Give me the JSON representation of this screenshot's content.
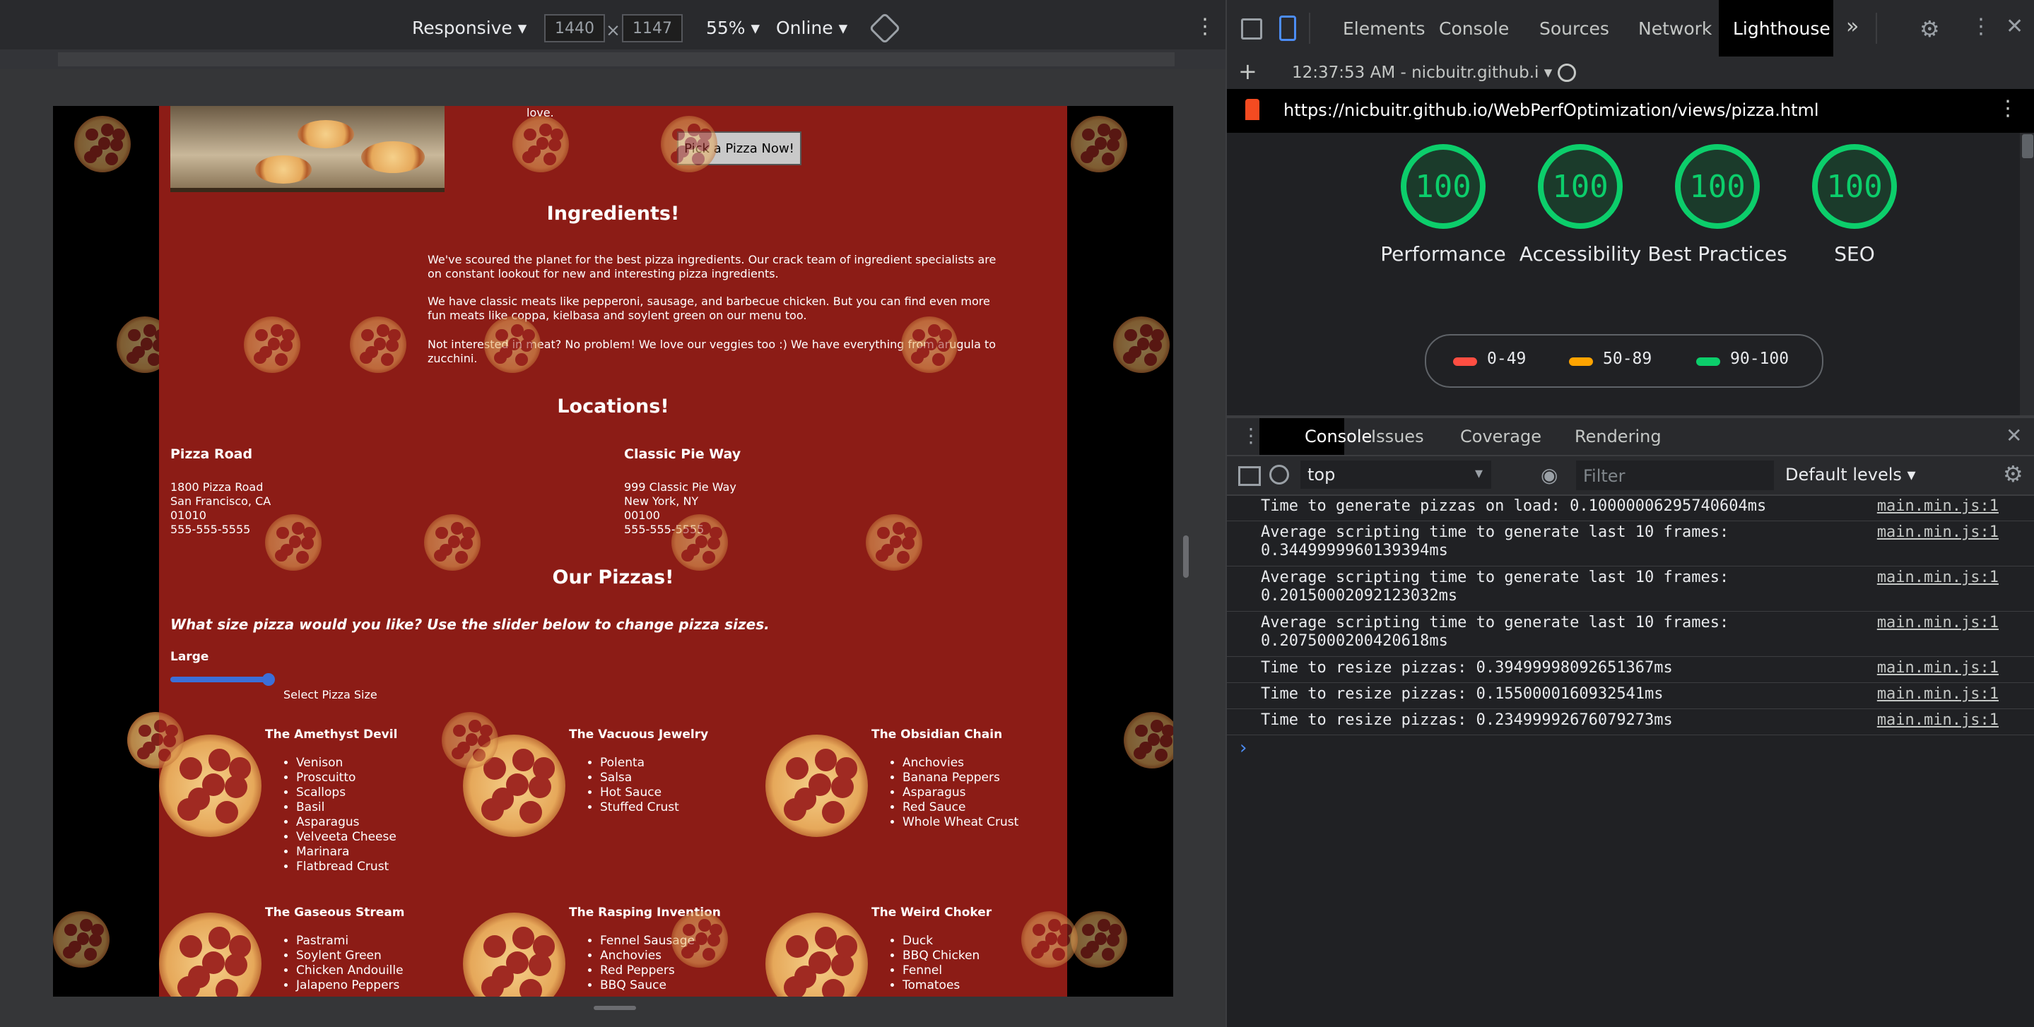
{
  "device_toolbar": {
    "mode": "Responsive",
    "width": "1440",
    "height": "1147",
    "times": "×",
    "zoom": "55%",
    "network": "Online"
  },
  "site": {
    "partial_text": "love.",
    "pick_button": "Pick a Pizza Now!",
    "ingredients_title": "Ingredients!",
    "ingredients_paras": [
      "We've scoured the planet for the best pizza ingredients. Our crack team of ingredient specialists are on constant lookout for new and interesting pizza ingredients.",
      "We have classic meats like pepperoni, sausage, and barbecue chicken. But you can find even more fun meats like coppa, kielbasa and soylent green on our menu too.",
      "Not interested in meat? No problem! We love our veggies too :) We have everything from arugula to zucchini."
    ],
    "locations_title": "Locations!",
    "locations": [
      {
        "name": "Pizza Road",
        "line1": "1800 Pizza Road",
        "line2": "San Francisco, CA",
        "line3": "01010",
        "line4": "555-555-5555"
      },
      {
        "name": "Classic Pie Way",
        "line1": "999 Classic Pie Way",
        "line2": "New York, NY",
        "line3": "00100",
        "line4": "555-555-5555"
      }
    ],
    "pizzas_title": "Our Pizzas!",
    "size_question": "What size pizza would you like? Use the slider below to change pizza sizes.",
    "size_value": "Large",
    "slider_label": "Select Pizza Size",
    "slider_fraction": 1.0,
    "pizzas": [
      {
        "name": "The Amethyst Devil",
        "toppings": [
          "Venison",
          "Proscuitto",
          "Scallops",
          "Basil",
          "Asparagus",
          "Velveeta Cheese",
          "Marinara",
          "Flatbread Crust"
        ]
      },
      {
        "name": "The Vacuous Jewelry",
        "toppings": [
          "Polenta",
          "Salsa",
          "Hot Sauce",
          "Stuffed Crust"
        ]
      },
      {
        "name": "The Obsidian Chain",
        "toppings": [
          "Anchovies",
          "Banana Peppers",
          "Asparagus",
          "Red Sauce",
          "Whole Wheat Crust"
        ]
      },
      {
        "name": "The Gaseous Stream",
        "toppings": [
          "Pastrami",
          "Soylent Green",
          "Chicken Andouille",
          "Jalapeno Peppers"
        ]
      },
      {
        "name": "The Rasping Invention",
        "toppings": [
          "Fennel Sausage",
          "Anchovies",
          "Red Peppers",
          "BBQ Sauce"
        ]
      },
      {
        "name": "The Weird Choker",
        "toppings": [
          "Duck",
          "BBQ Chicken",
          "Fennel",
          "Tomatoes"
        ]
      }
    ]
  },
  "devtools": {
    "tabs": [
      "Elements",
      "Console",
      "Sources",
      "Network",
      "Lighthouse"
    ],
    "active_tab": "Lighthouse",
    "overflow": "»",
    "report_time": "12:37:53 AM - nicbuitr.github.i",
    "url": "https://nicbuitr.github.io/WebPerfOptimization/views/pizza.html",
    "scores": [
      {
        "value": "100",
        "label": "Performance"
      },
      {
        "value": "100",
        "label": "Accessibility"
      },
      {
        "value": "100",
        "label": "Best Practices"
      },
      {
        "value": "100",
        "label": "SEO"
      }
    ],
    "legend": [
      {
        "range": "0-49",
        "color": "#ff4e42"
      },
      {
        "range": "50-89",
        "color": "#ffa400"
      },
      {
        "range": "90-100",
        "color": "#0cce6b"
      }
    ],
    "drawer_tabs": [
      "Console",
      "Issues",
      "Coverage",
      "Rendering"
    ],
    "context": "top",
    "filter_placeholder": "Filter",
    "levels": "Default levels",
    "console_lines": [
      {
        "msg": "Time to generate pizzas on load: 0.10000006295740604ms",
        "src": "main.min.js:1"
      },
      {
        "msg": "Average scripting time to generate last 10 frames:\n0.3449999960139394ms",
        "src": "main.min.js:1"
      },
      {
        "msg": "Average scripting time to generate last 10 frames:\n0.20150002092123032ms",
        "src": "main.min.js:1"
      },
      {
        "msg": "Average scripting time to generate last 10 frames:\n0.2075000200420618ms",
        "src": "main.min.js:1"
      },
      {
        "msg": "Time to resize pizzas: 0.39499998092651367ms",
        "src": "main.min.js:1"
      },
      {
        "msg": "Time to resize pizzas: 0.1550000160932541ms",
        "src": "main.min.js:1"
      },
      {
        "msg": "Time to resize pizzas: 0.23499992676079273ms",
        "src": "main.min.js:1"
      }
    ],
    "prompt": "›"
  }
}
